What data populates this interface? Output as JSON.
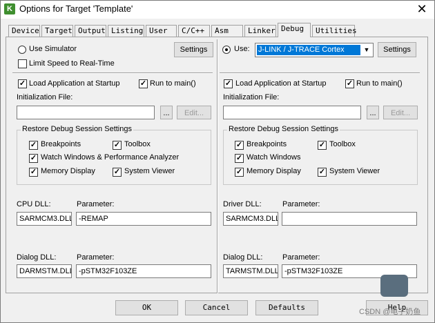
{
  "window": {
    "title": "Options for Target 'Template'"
  },
  "tabs": [
    {
      "label": "Device"
    },
    {
      "label": "Target"
    },
    {
      "label": "Output"
    },
    {
      "label": "Listing"
    },
    {
      "label": "User"
    },
    {
      "label": "C/C++"
    },
    {
      "label": "Asm"
    },
    {
      "label": "Linker"
    },
    {
      "label": "Debug"
    },
    {
      "label": "Utilities"
    }
  ],
  "left": {
    "use_simulator": "Use Simulator",
    "limit_speed": "Limit Speed to Real-Time",
    "settings": "Settings",
    "load_app": "Load Application at Startup",
    "run_to_main": "Run to main()",
    "init_file": "Initialization File:",
    "browse": "...",
    "edit": "Edit...",
    "restore_group": "Restore Debug Session Settings",
    "breakpoints": "Breakpoints",
    "toolbox": "Toolbox",
    "watch": "Watch Windows & Performance Analyzer",
    "memory": "Memory Display",
    "sysviewer": "System Viewer",
    "dll_label": "CPU DLL:",
    "param_label": "Parameter:",
    "dll_value": "SARMCM3.DLL",
    "param_value": "-REMAP",
    "dialog_dll_label": "Dialog DLL:",
    "dialog_param_label": "Parameter:",
    "dialog_dll_value": "DARMSTM.DLL",
    "dialog_param_value": "-pSTM32F103ZE"
  },
  "right": {
    "use": "Use:",
    "debugger": "J-LINK / J-TRACE Cortex",
    "settings": "Settings",
    "load_app": "Load Application at Startup",
    "run_to_main": "Run to main()",
    "init_file": "Initialization File:",
    "browse": "...",
    "edit": "Edit...",
    "restore_group": "Restore Debug Session Settings",
    "breakpoints": "Breakpoints",
    "toolbox": "Toolbox",
    "watch": "Watch Windows",
    "memory": "Memory Display",
    "sysviewer": "System Viewer",
    "dll_label": "Driver DLL:",
    "param_label": "Parameter:",
    "dll_value": "SARMCM3.DLL",
    "param_value": "",
    "dialog_dll_label": "Dialog DLL:",
    "dialog_param_label": "Parameter:",
    "dialog_dll_value": "TARMSTM.DLL",
    "dialog_param_value": "-pSTM32F103ZE"
  },
  "buttons": {
    "ok": "OK",
    "cancel": "Cancel",
    "defaults": "Defaults",
    "help": "Help"
  },
  "watermark": "CSDN @电子奶鱼",
  "checked_mark": "✓",
  "icons": {
    "title": "keil-logo-icon",
    "close": "close-icon"
  }
}
